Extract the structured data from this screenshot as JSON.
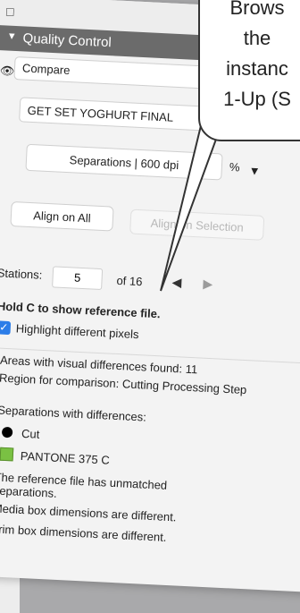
{
  "toolbar": {
    "lock_icon": "lock-icon",
    "arrow_icon": "arrow-right-icon"
  },
  "quality_control": {
    "title": "Quality Control",
    "compare_mode": "Compare",
    "reference_file": "GET SET YOGHURT FINAL",
    "view_mode": "Separations  |  600 dpi",
    "zoom_partial": "%"
  },
  "buttons": {
    "align_all": "Align on All",
    "align_selection": "Align on Selection"
  },
  "stations": {
    "label": "Stations:",
    "value": "5",
    "total": "of 16"
  },
  "hint": "Hold C to show reference file.",
  "highlight": {
    "label": "Highlight different pixels",
    "checked": true
  },
  "messages": [
    {
      "type": "info",
      "text": "Areas with visual differences found: 11"
    },
    {
      "type": "info",
      "text": "Region for comparison: Cutting Processing Step"
    },
    {
      "type": "info",
      "text": "Separations with differences:"
    },
    {
      "type": "separation",
      "text": "Cut",
      "color": "#000000"
    },
    {
      "type": "separation",
      "text": "PANTONE 375 C",
      "color": "#7ac143"
    },
    {
      "type": "warning",
      "text": "The reference file has unmatched separations."
    },
    {
      "type": "warning",
      "text": "Media box dimensions are different."
    },
    {
      "type": "warning",
      "text": "Trim box dimensions are different."
    }
  ],
  "callout": {
    "lines": [
      "Brows",
      "the",
      "instanc",
      "1-Up (S"
    ]
  },
  "colors": {
    "header": "#6b6b6b",
    "checkbox": "#2c7de8",
    "info": "#2e90e6",
    "warning": "#e6a900"
  }
}
